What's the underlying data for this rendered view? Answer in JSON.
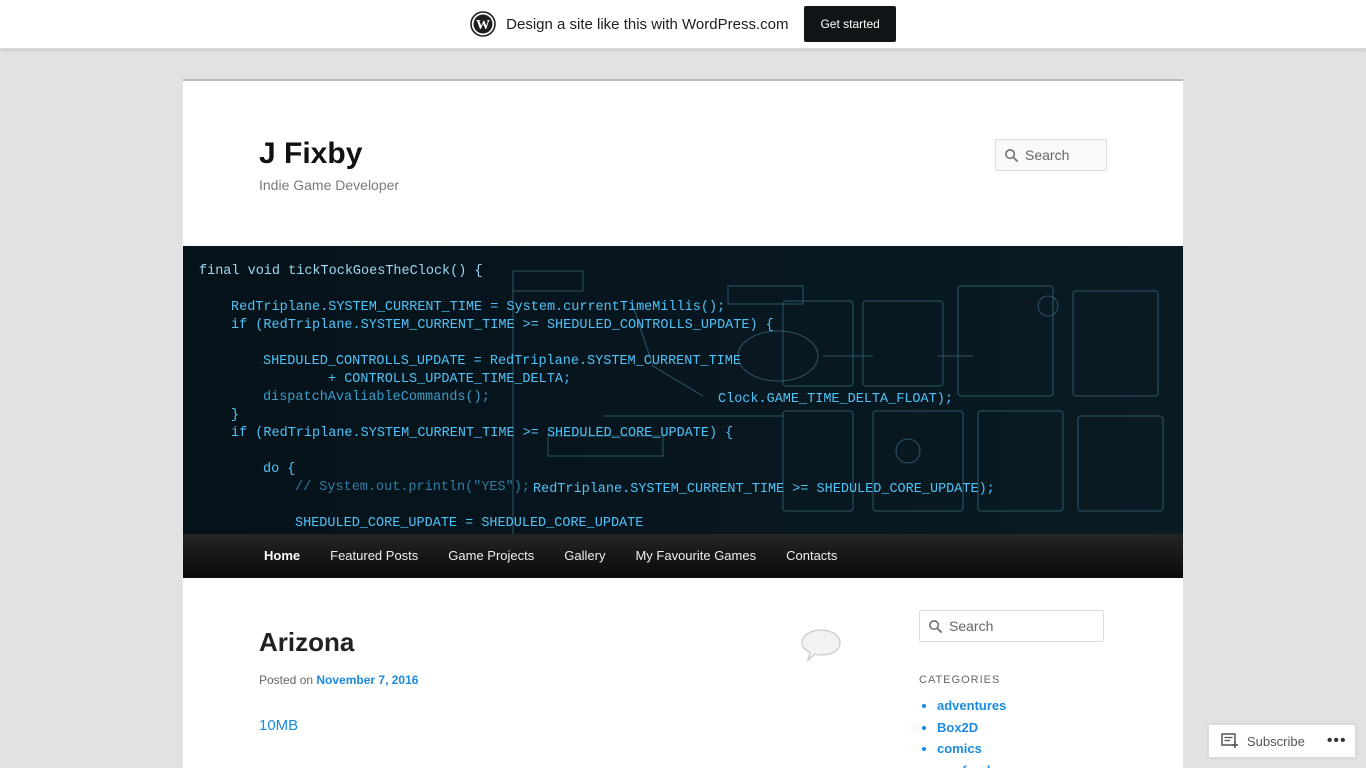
{
  "wp_banner": {
    "text": "Design a site like this with WordPress.com",
    "button": "Get started"
  },
  "site": {
    "title": "J Fixby",
    "description": "Indie Game Developer"
  },
  "header_search": {
    "placeholder": "Search"
  },
  "header_code": [
    "final void tickTockGoesTheClock() {",
    "RedTriplane.SYSTEM_CURRENT_TIME = System.currentTimeMillis();",
    "if (RedTriplane.SYSTEM_CURRENT_TIME >= SHEDULED_CONTROLLS_UPDATE) {",
    "SHEDULED_CONTROLLS_UPDATE = RedTriplane.SYSTEM_CURRENT_TIME",
    "+ CONTROLLS_UPDATE_TIME_DELTA;",
    "dispatchAvaliableCommands();",
    "}",
    "if (RedTriplane.SYSTEM_CURRENT_TIME >= SHEDULED_CORE_UPDATE) {",
    "do {",
    "// System.out.println(\"YES\");",
    "SHEDULED_CORE_UPDATE = SHEDULED_CORE_UPDATE",
    "RedTriplane.SYSTEM_CURRENT_TIME >= SHEDULED_CORE_UPDATE);",
    "Clock.GAME_TIME_DELTA_FLOAT);"
  ],
  "nav": {
    "items": [
      "Home",
      "Featured Posts",
      "Game Projects",
      "Gallery",
      "My Favourite Games",
      "Contacts"
    ]
  },
  "post": {
    "title": "Arizona",
    "posted_prefix": "Posted on",
    "date": "November 7, 2016",
    "link": "10MB"
  },
  "sidebar": {
    "search_placeholder": "Search",
    "categories_heading": "CATEGORIES",
    "categories": [
      "adventures",
      "Box2D",
      "comics",
      "eye food"
    ]
  },
  "subscribe": {
    "label": "Subscribe",
    "more": "•••"
  },
  "colors": {
    "accent": "#1b8be0",
    "nav_bg": "#1a1a1a",
    "code_cyan": "#4fc3f7"
  }
}
